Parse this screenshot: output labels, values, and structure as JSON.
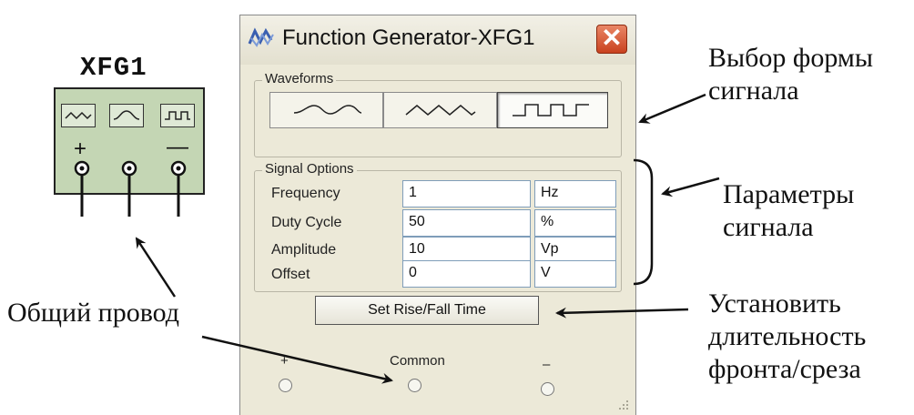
{
  "symbol": {
    "title": "XFG1",
    "plus": "+",
    "minus": "—",
    "wave_icons": [
      "triangle-wave-icon",
      "sine-wave-icon",
      "square-wave-icon"
    ]
  },
  "window": {
    "title": "Function Generator-XFG1",
    "waveforms_label": "Waveforms",
    "waveforms": [
      {
        "icon": "sine-wave-icon",
        "selected": false
      },
      {
        "icon": "triangle-wave-icon",
        "selected": false
      },
      {
        "icon": "square-wave-icon",
        "selected": true
      }
    ],
    "signal_options_label": "Signal Options",
    "options": [
      {
        "label": "Frequency",
        "value": "1",
        "unit": "Hz"
      },
      {
        "label": "Duty Cycle",
        "value": "50",
        "unit": "%"
      },
      {
        "label": "Amplitude",
        "value": "10",
        "unit": "Vp"
      },
      {
        "label": "Offset",
        "value": "0",
        "unit": "V"
      }
    ],
    "set_rise_fall": "Set Rise/Fall Time",
    "terminals": {
      "plus": "+",
      "common": "Common",
      "minus": "–"
    }
  },
  "annotations": {
    "waveform_select": [
      "Выбор формы",
      "сигнала"
    ],
    "signal_params": [
      "Параметры",
      "сигнала"
    ],
    "common_wire": "Общий провод",
    "rise_fall": [
      "Установить",
      "длительность",
      "фронта/среза"
    ]
  },
  "colors": {
    "symbol_fill": "#c4d6b4",
    "window_bg": "#ece9d8",
    "close_button": "#c9421f"
  }
}
